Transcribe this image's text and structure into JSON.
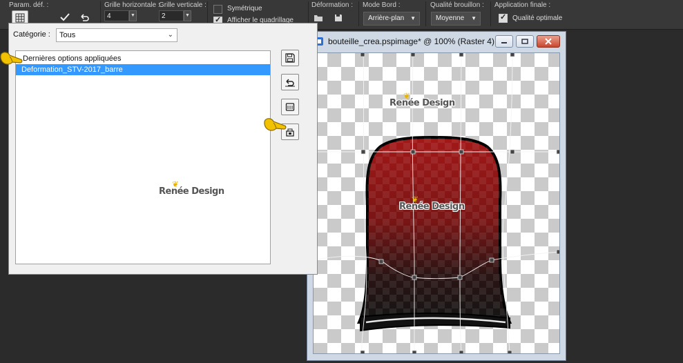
{
  "toolbar": {
    "presets_label": "Param. déf. :",
    "grid_horizontal_label": "Grille horizontale :",
    "grid_horizontal_value": "4",
    "grid_vertical_label": "Grille verticale :",
    "grid_vertical_value": "2",
    "symmetric_label": "Symétrique",
    "show_grid_label": "Afficher le quadrillage",
    "deformation_label": "Déformation :",
    "edge_mode_label": "Mode Bord :",
    "edge_mode_value": "Arrière-plan",
    "draft_quality_label": "Qualité brouillon :",
    "draft_quality_value": "Moyenne",
    "final_apply_label": "Application finale :",
    "optimal_quality_label": "Qualité optimale"
  },
  "dialog": {
    "category_label": "Catégorie :",
    "category_value": "Tous",
    "list_items": [
      "Dernières options appliquées",
      "Deformation_STV-2017_barre"
    ],
    "selected_index": 1
  },
  "watermark": {
    "text": "Renée Design"
  },
  "image_window": {
    "title": "bouteille_crea.pspimage* @ 100% (Raster 4)"
  },
  "colors": {
    "selection_blue": "#3399ff",
    "bottle_red": "#a01818",
    "pointer_yellow": "#f2c200"
  }
}
